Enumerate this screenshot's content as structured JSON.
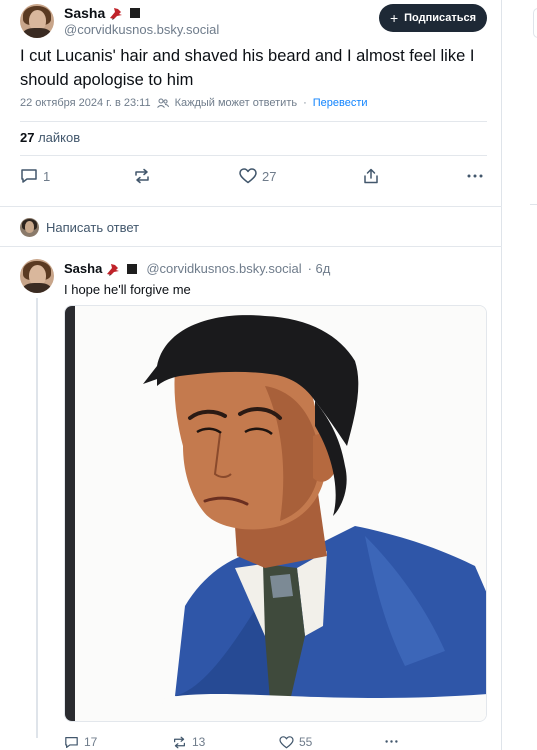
{
  "post": {
    "author_name": "Sasha",
    "author_handle": "@corvidkusnos.bsky.social",
    "follow_label": "Подписаться",
    "text": "I cut Lucanis' hair and shaved his beard and I almost feel like I should apologise to him",
    "timestamp": "22 октября 2024 г. в 23:11",
    "reply_permission": "Каждый может ответить",
    "translate_label": "Перевести",
    "likes_count": "27",
    "likes_label": "лайков",
    "replies": "1",
    "reposts": "",
    "likes": "27"
  },
  "reply_composer": {
    "placeholder": "Написать ответ"
  },
  "reply": {
    "author_name": "Sasha",
    "author_handle": "@corvidkusnos.bsky.social",
    "age": "· 6д",
    "text": "I hope he'll forgive me",
    "replies": "17",
    "reposts": "13",
    "likes": "55"
  },
  "colors": {
    "accent": "#1083fe",
    "follow_bg": "#1e2936",
    "muted": "#6f7c8b",
    "jacket": "#2f56a8",
    "hair": "#1a1a1c",
    "skin": "#c47a4e"
  },
  "icons": [
    "bird-icon",
    "square-icon",
    "plus-icon",
    "people-icon",
    "reply-icon",
    "repost-icon",
    "heart-icon",
    "share-icon",
    "more-icon"
  ]
}
